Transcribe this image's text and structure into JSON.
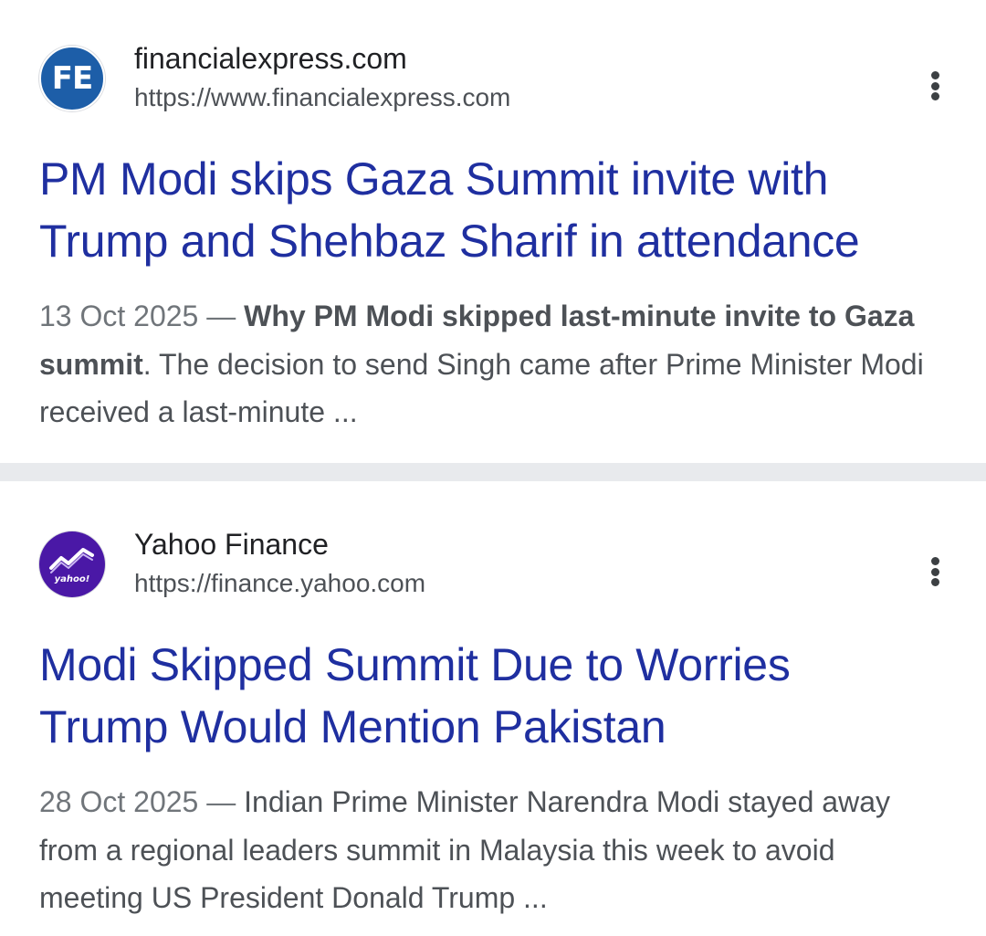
{
  "results": [
    {
      "site_name": "financialexpress.com",
      "url": "https://www.financialexpress.com",
      "favicon_text": "FE",
      "favicon_icon": "financialexpress-logo-icon",
      "title_line1": "PM Modi skips Gaza Summit invite with",
      "title_line2": "Trump and Shehbaz Sharif in attendance",
      "date": "13 Oct 2025",
      "dash": " — ",
      "snippet_bold": "Why PM Modi skipped last-minute invite to Gaza summit",
      "snippet_rest": ". The decision to send Singh came after Prime Minister Modi received a last-minute ..."
    },
    {
      "site_name": "Yahoo Finance",
      "url": "https://finance.yahoo.com",
      "favicon_text": "yahoo!",
      "favicon_icon": "yahoo-finance-logo-icon",
      "title_line1": "Modi Skipped Summit Due to Worries",
      "title_line2": "Trump Would Mention Pakistan",
      "date": "28 Oct 2025",
      "dash": " — ",
      "snippet_text": "Indian Prime Minister Narendra Modi stayed away from a regional leaders summit in Malaysia this week to avoid meeting US President Donald Trump ..."
    }
  ],
  "colors": {
    "title_link": "#1f2fa0",
    "snippet": "#4d5156",
    "separator": "#e8eaed",
    "fe_brand": "#1d5ea8",
    "yahoo_brand": "#4a18a6"
  }
}
